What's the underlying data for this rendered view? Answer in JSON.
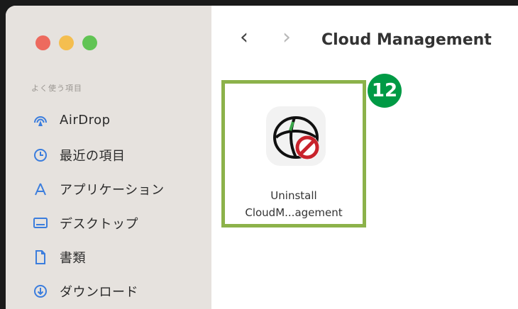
{
  "window": {
    "title": "Cloud Management",
    "nav": {
      "back": "‹",
      "forward": "›"
    }
  },
  "sidebar": {
    "section_title": "よく使う項目",
    "items": [
      {
        "label": "AirDrop",
        "icon": "airdrop-icon"
      },
      {
        "label": "最近の項目",
        "icon": "clock-icon"
      },
      {
        "label": "アプリケーション",
        "icon": "applications-icon"
      },
      {
        "label": "デスクトップ",
        "icon": "desktop-icon"
      },
      {
        "label": "書類",
        "icon": "document-icon"
      },
      {
        "label": "ダウンロード",
        "icon": "download-icon"
      }
    ]
  },
  "main": {
    "files": [
      {
        "name_line1": "Uninstall",
        "name_line2": "CloudM...agement",
        "icon": "uninstall-app-icon",
        "highlighted": true
      }
    ],
    "step_badge": "12"
  },
  "colors": {
    "highlight_border": "#8cb24a",
    "badge": "#009a45",
    "sidebar_icon": "#3b7ddd"
  }
}
